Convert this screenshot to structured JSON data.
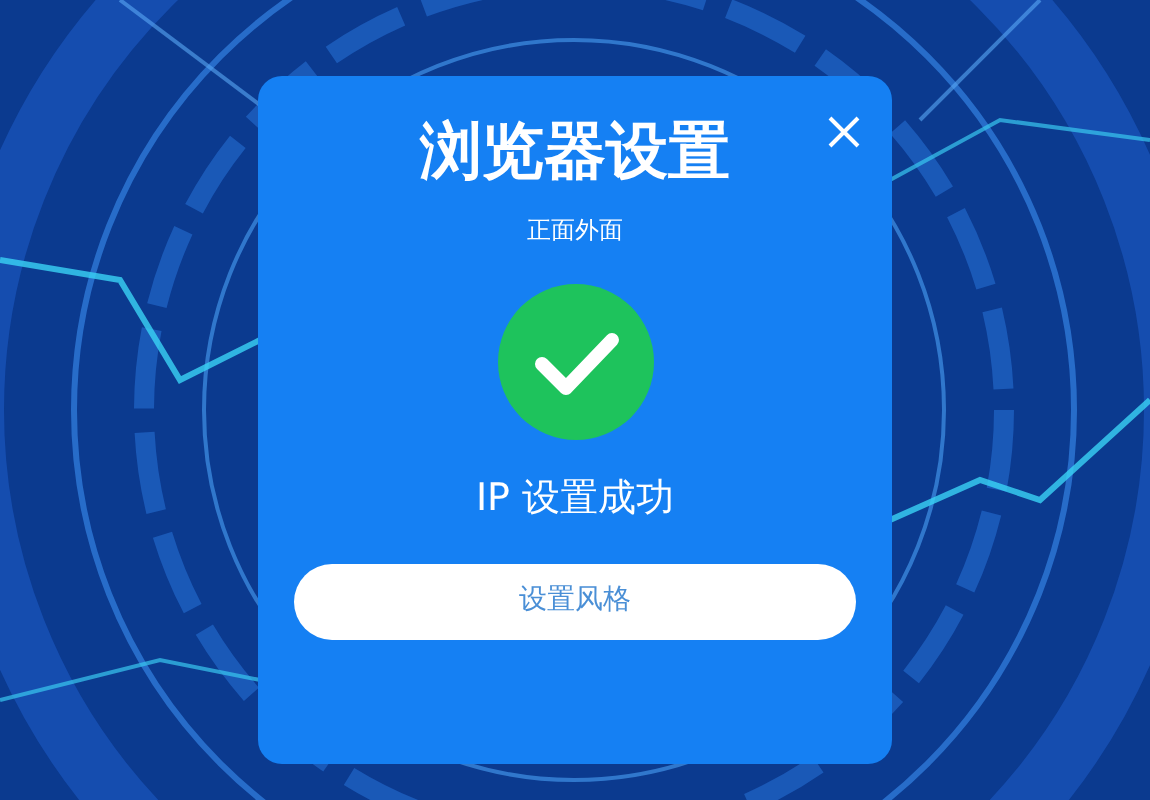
{
  "dialog": {
    "title": "浏览器设置",
    "subtitle": "正面外面",
    "message": "IP 设置成功",
    "button": "设置风格"
  }
}
